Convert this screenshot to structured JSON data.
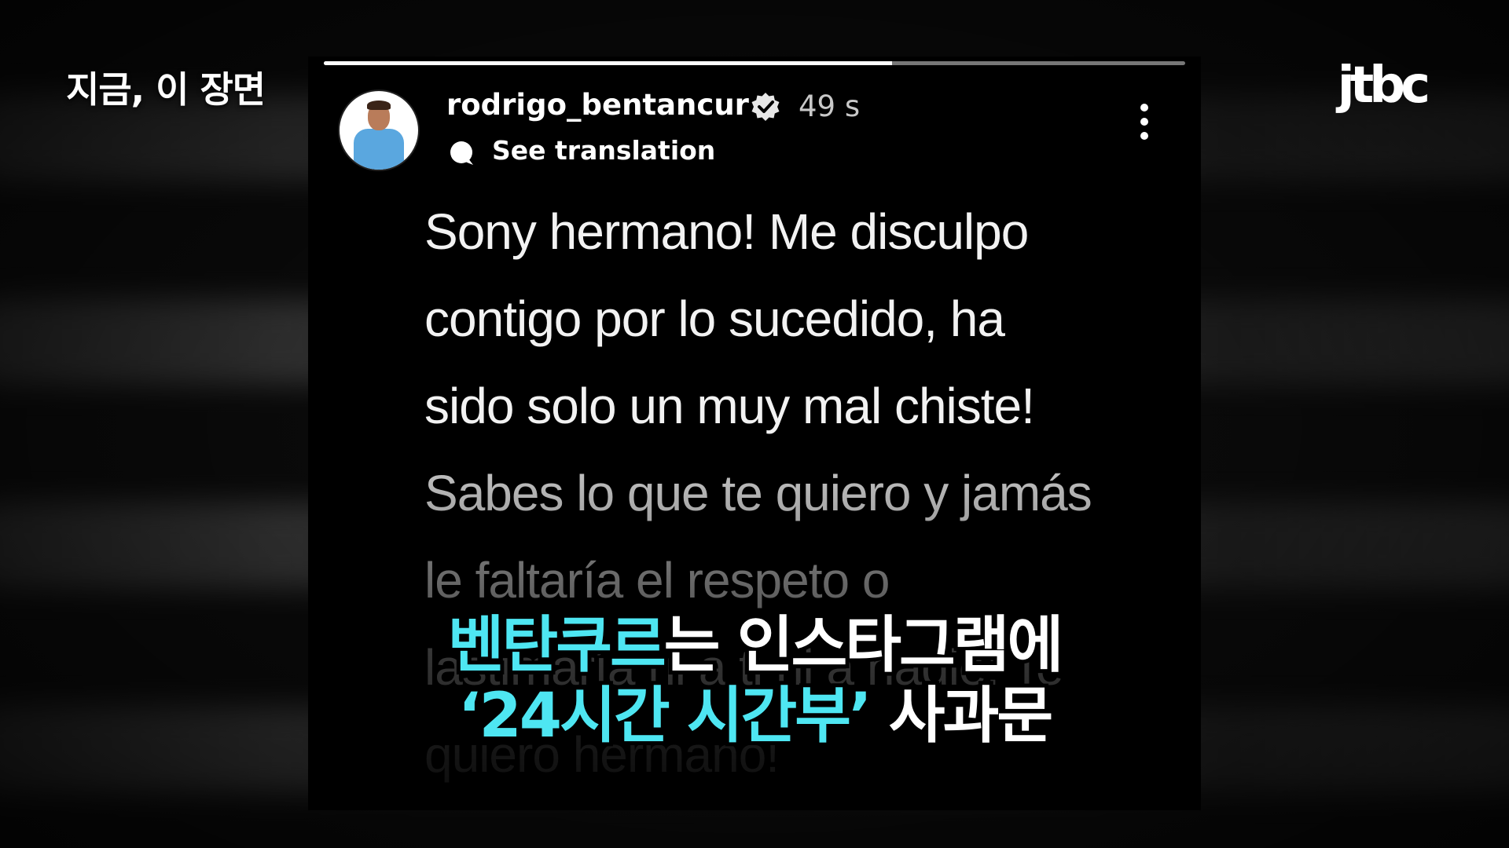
{
  "broadcast": {
    "show_title": "지금, 이 장면",
    "channel_logo": "jtbc"
  },
  "story": {
    "progress": 0.66,
    "avatar_icon": "profile-photo",
    "username": "rodrigo_bentancur",
    "verified_icon": "verified-badge-icon",
    "time_ago": "49 s",
    "translate_label": "See translation",
    "menu_icon": "more-options-icon",
    "caption_lines": [
      "Sony hermano! Me disculpo",
      "contigo por lo sucedido, ha",
      "sido solo un muy mal chiste!",
      "Sabes lo que te quiero y jamás",
      "le faltaría el respeto o",
      "lastimaría ni a ti ni a nadie! Te",
      "quiero hermano!"
    ]
  },
  "subtitle": {
    "line1_highlight": "벤탄쿠르",
    "line1_rest": "는 인스타그램에",
    "line2_highlight": "‘24시간 시간부’",
    "line2_rest": " 사과문",
    "highlight_color": "#4ee6f2"
  }
}
